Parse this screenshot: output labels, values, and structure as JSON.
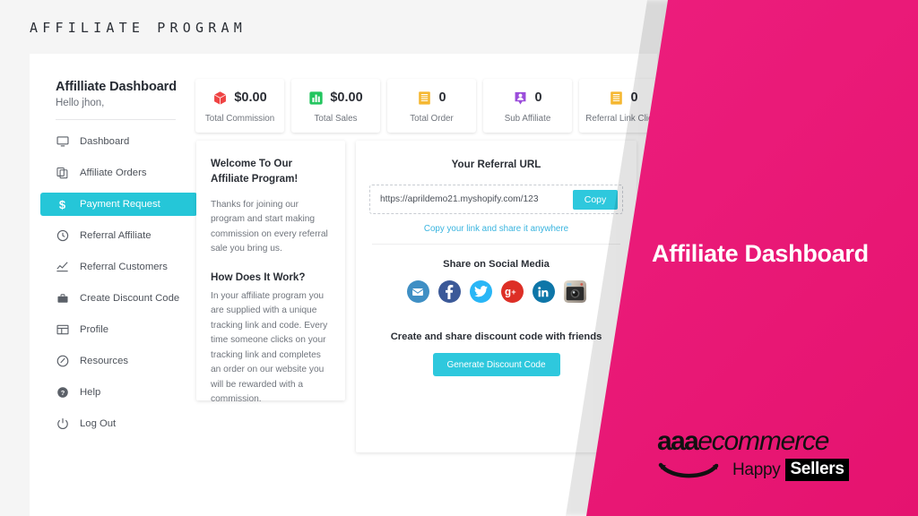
{
  "header": {
    "brand_title": "AFFILIATE PROGRAM"
  },
  "sidebar": {
    "title": "Affilliate Dashboard",
    "greeting": "Hello jhon,",
    "items": [
      {
        "label": "Dashboard",
        "icon": "monitor-icon",
        "active": false
      },
      {
        "label": "Affiliate Orders",
        "icon": "copy-icon",
        "active": false
      },
      {
        "label": "Payment Request",
        "icon": "dollar-icon",
        "active": true
      },
      {
        "label": "Referral Affiliate",
        "icon": "history-icon",
        "active": false
      },
      {
        "label": "Referral Customers",
        "icon": "line-chart-icon",
        "active": false
      },
      {
        "label": "Create Discount Code",
        "icon": "briefcase-icon",
        "active": false
      },
      {
        "label": "Profile",
        "icon": "grid-icon",
        "active": false
      },
      {
        "label": "Resources",
        "icon": "tag-icon",
        "active": false
      },
      {
        "label": "Help",
        "icon": "question-circle-icon",
        "active": false
      },
      {
        "label": "Log Out",
        "icon": "power-icon",
        "active": false
      }
    ],
    "active_color": "#25c6d8"
  },
  "stats": [
    {
      "value": "$0.00",
      "label": "Total Commission",
      "icon": "box-icon",
      "color": "#ef4444"
    },
    {
      "value": "$0.00",
      "label": "Total Sales",
      "icon": "bar-chart-icon",
      "color": "#22c55e"
    },
    {
      "value": "0",
      "label": "Total Order",
      "icon": "receipt-icon",
      "color": "#f5b731"
    },
    {
      "value": "0",
      "label": "Sub Affiliate",
      "icon": "user-badge-icon",
      "color": "#9b4ddb"
    },
    {
      "value": "0",
      "label": "Referral Link Clicks",
      "icon": "receipt-icon",
      "color": "#f5b731"
    }
  ],
  "welcome": {
    "heading": "Welcome To Our Affiliate Program!",
    "body": "Thanks for joining our program and start making commission on every referral sale you bring us.",
    "heading2": "How Does It Work?",
    "body2": "In your affiliate program you are supplied with a unique tracking link and code. Every time someone clicks on your tracking link and completes an order on our website you will be rewarded with a commission."
  },
  "referral": {
    "title": "Your Referral URL",
    "url": "https://aprildemo21.myshopify.com/123",
    "placeholder": "https://aprildemo21.myshopify.com/123",
    "copy_label": "Copy",
    "hint": "Copy your link and share it anywhere",
    "button_color": "#2ec8dd",
    "hint_color": "#39b4df"
  },
  "social": {
    "title": "Share on Social Media",
    "items": [
      {
        "name": "email-icon",
        "color": "#3f8fc4"
      },
      {
        "name": "facebook-icon",
        "color": "#3b5998"
      },
      {
        "name": "twitter-icon",
        "color": "#29b6f6"
      },
      {
        "name": "google-plus-icon",
        "color": "#dd2f26"
      },
      {
        "name": "linkedin-icon",
        "color": "#0e76a8"
      },
      {
        "name": "instagram-icon",
        "color": "#b9a08a"
      }
    ]
  },
  "discount": {
    "title": "Create and share discount code with friends",
    "button_label": "Generate Discount Code"
  },
  "promo": {
    "title": "Affiliate Dashboard",
    "panel_color": "#e8127e",
    "logo_aaa": "aaa",
    "logo_ecommerce": "ecommerce",
    "logo_happy": "Happy",
    "logo_sellers": "Sellers"
  }
}
